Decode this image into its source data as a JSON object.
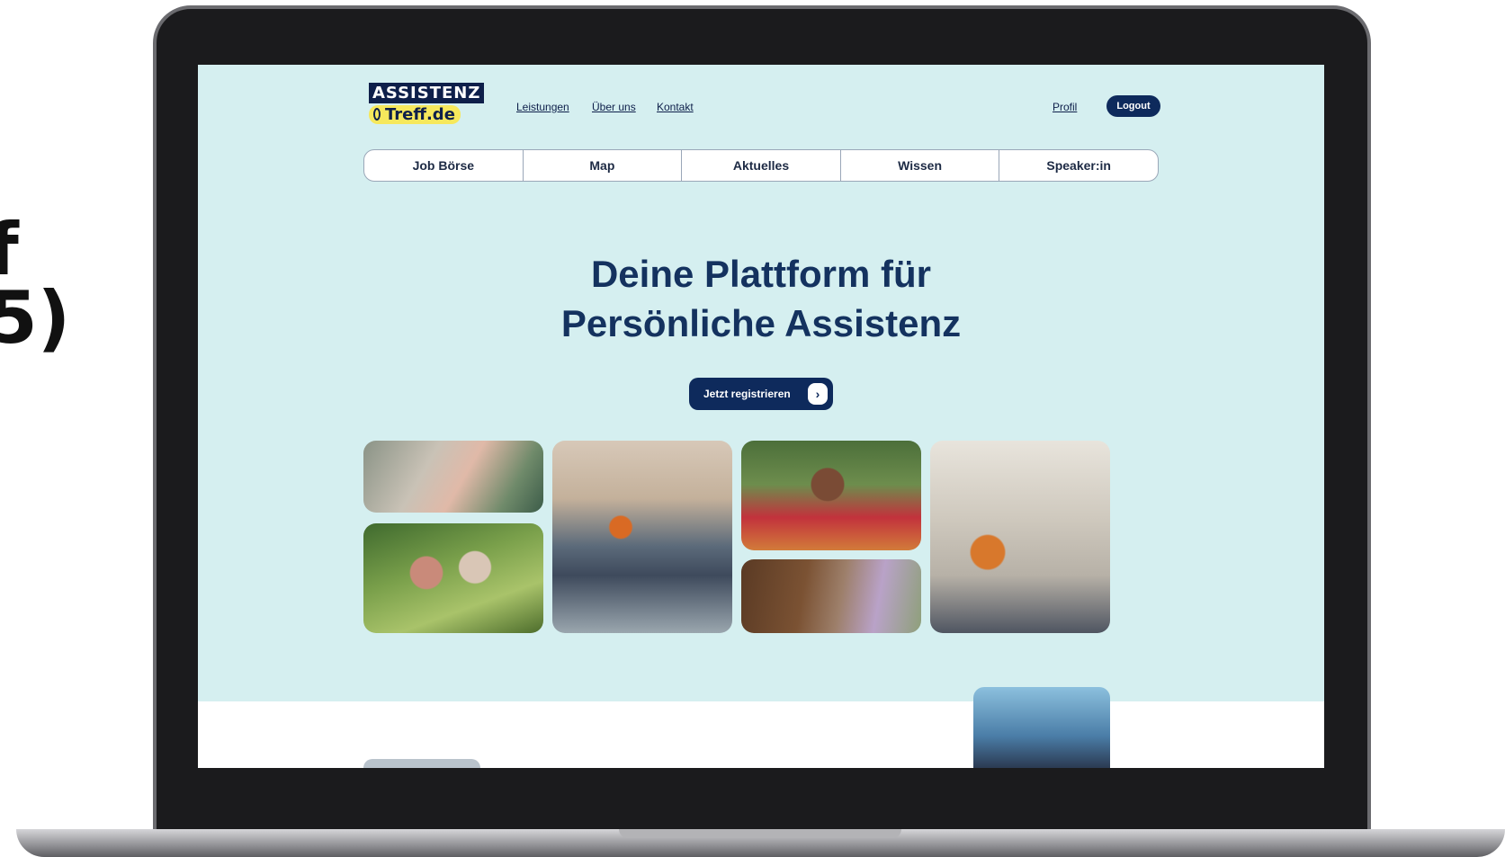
{
  "edge_text": [
    "f",
    "5)"
  ],
  "site": {
    "logo_top": "ASSISTENZ",
    "logo_bottom": "Treff.de",
    "nav_links": [
      "Leistungen",
      "Über uns",
      "Kontakt"
    ],
    "profile_link": "Profil",
    "logout_label": "Logout",
    "tabs": [
      "Job Börse",
      "Map",
      "Aktuelles",
      "Wissen",
      "Speaker:in"
    ],
    "hero_line1": "Deine Plattform für",
    "hero_line2": "Persönliche Assistenz",
    "cta_label": "Jetzt registrieren",
    "cta_icon": "chevron-right-icon"
  },
  "colors": {
    "screen_bg": "#d5eff0",
    "navy": "#0e2a5c",
    "logo_yellow": "#f6e85c"
  },
  "photos": [
    "woman-in-car-photo",
    "two-women-outdoors-photo",
    "basketball-wheelchair-photo",
    "selfie-friends-photo",
    "horse-therapy-photo",
    "child-walker-photo"
  ]
}
